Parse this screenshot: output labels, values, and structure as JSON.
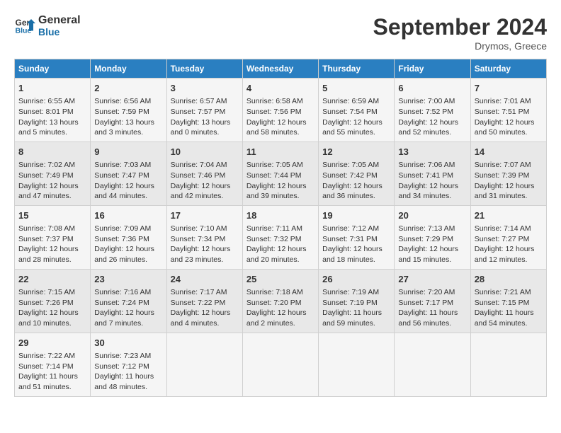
{
  "header": {
    "logo_line1": "General",
    "logo_line2": "Blue",
    "month_title": "September 2024",
    "subtitle": "Drymos, Greece"
  },
  "columns": [
    "Sunday",
    "Monday",
    "Tuesday",
    "Wednesday",
    "Thursday",
    "Friday",
    "Saturday"
  ],
  "weeks": [
    [
      {
        "day": "1",
        "lines": [
          "Sunrise: 6:55 AM",
          "Sunset: 8:01 PM",
          "Daylight: 13 hours",
          "and 5 minutes."
        ]
      },
      {
        "day": "2",
        "lines": [
          "Sunrise: 6:56 AM",
          "Sunset: 7:59 PM",
          "Daylight: 13 hours",
          "and 3 minutes."
        ]
      },
      {
        "day": "3",
        "lines": [
          "Sunrise: 6:57 AM",
          "Sunset: 7:57 PM",
          "Daylight: 13 hours",
          "and 0 minutes."
        ]
      },
      {
        "day": "4",
        "lines": [
          "Sunrise: 6:58 AM",
          "Sunset: 7:56 PM",
          "Daylight: 12 hours",
          "and 58 minutes."
        ]
      },
      {
        "day": "5",
        "lines": [
          "Sunrise: 6:59 AM",
          "Sunset: 7:54 PM",
          "Daylight: 12 hours",
          "and 55 minutes."
        ]
      },
      {
        "day": "6",
        "lines": [
          "Sunrise: 7:00 AM",
          "Sunset: 7:52 PM",
          "Daylight: 12 hours",
          "and 52 minutes."
        ]
      },
      {
        "day": "7",
        "lines": [
          "Sunrise: 7:01 AM",
          "Sunset: 7:51 PM",
          "Daylight: 12 hours",
          "and 50 minutes."
        ]
      }
    ],
    [
      {
        "day": "8",
        "lines": [
          "Sunrise: 7:02 AM",
          "Sunset: 7:49 PM",
          "Daylight: 12 hours",
          "and 47 minutes."
        ]
      },
      {
        "day": "9",
        "lines": [
          "Sunrise: 7:03 AM",
          "Sunset: 7:47 PM",
          "Daylight: 12 hours",
          "and 44 minutes."
        ]
      },
      {
        "day": "10",
        "lines": [
          "Sunrise: 7:04 AM",
          "Sunset: 7:46 PM",
          "Daylight: 12 hours",
          "and 42 minutes."
        ]
      },
      {
        "day": "11",
        "lines": [
          "Sunrise: 7:05 AM",
          "Sunset: 7:44 PM",
          "Daylight: 12 hours",
          "and 39 minutes."
        ]
      },
      {
        "day": "12",
        "lines": [
          "Sunrise: 7:05 AM",
          "Sunset: 7:42 PM",
          "Daylight: 12 hours",
          "and 36 minutes."
        ]
      },
      {
        "day": "13",
        "lines": [
          "Sunrise: 7:06 AM",
          "Sunset: 7:41 PM",
          "Daylight: 12 hours",
          "and 34 minutes."
        ]
      },
      {
        "day": "14",
        "lines": [
          "Sunrise: 7:07 AM",
          "Sunset: 7:39 PM",
          "Daylight: 12 hours",
          "and 31 minutes."
        ]
      }
    ],
    [
      {
        "day": "15",
        "lines": [
          "Sunrise: 7:08 AM",
          "Sunset: 7:37 PM",
          "Daylight: 12 hours",
          "and 28 minutes."
        ]
      },
      {
        "day": "16",
        "lines": [
          "Sunrise: 7:09 AM",
          "Sunset: 7:36 PM",
          "Daylight: 12 hours",
          "and 26 minutes."
        ]
      },
      {
        "day": "17",
        "lines": [
          "Sunrise: 7:10 AM",
          "Sunset: 7:34 PM",
          "Daylight: 12 hours",
          "and 23 minutes."
        ]
      },
      {
        "day": "18",
        "lines": [
          "Sunrise: 7:11 AM",
          "Sunset: 7:32 PM",
          "Daylight: 12 hours",
          "and 20 minutes."
        ]
      },
      {
        "day": "19",
        "lines": [
          "Sunrise: 7:12 AM",
          "Sunset: 7:31 PM",
          "Daylight: 12 hours",
          "and 18 minutes."
        ]
      },
      {
        "day": "20",
        "lines": [
          "Sunrise: 7:13 AM",
          "Sunset: 7:29 PM",
          "Daylight: 12 hours",
          "and 15 minutes."
        ]
      },
      {
        "day": "21",
        "lines": [
          "Sunrise: 7:14 AM",
          "Sunset: 7:27 PM",
          "Daylight: 12 hours",
          "and 12 minutes."
        ]
      }
    ],
    [
      {
        "day": "22",
        "lines": [
          "Sunrise: 7:15 AM",
          "Sunset: 7:26 PM",
          "Daylight: 12 hours",
          "and 10 minutes."
        ]
      },
      {
        "day": "23",
        "lines": [
          "Sunrise: 7:16 AM",
          "Sunset: 7:24 PM",
          "Daylight: 12 hours",
          "and 7 minutes."
        ]
      },
      {
        "day": "24",
        "lines": [
          "Sunrise: 7:17 AM",
          "Sunset: 7:22 PM",
          "Daylight: 12 hours",
          "and 4 minutes."
        ]
      },
      {
        "day": "25",
        "lines": [
          "Sunrise: 7:18 AM",
          "Sunset: 7:20 PM",
          "Daylight: 12 hours",
          "and 2 minutes."
        ]
      },
      {
        "day": "26",
        "lines": [
          "Sunrise: 7:19 AM",
          "Sunset: 7:19 PM",
          "Daylight: 11 hours",
          "and 59 minutes."
        ]
      },
      {
        "day": "27",
        "lines": [
          "Sunrise: 7:20 AM",
          "Sunset: 7:17 PM",
          "Daylight: 11 hours",
          "and 56 minutes."
        ]
      },
      {
        "day": "28",
        "lines": [
          "Sunrise: 7:21 AM",
          "Sunset: 7:15 PM",
          "Daylight: 11 hours",
          "and 54 minutes."
        ]
      }
    ],
    [
      {
        "day": "29",
        "lines": [
          "Sunrise: 7:22 AM",
          "Sunset: 7:14 PM",
          "Daylight: 11 hours",
          "and 51 minutes."
        ]
      },
      {
        "day": "30",
        "lines": [
          "Sunrise: 7:23 AM",
          "Sunset: 7:12 PM",
          "Daylight: 11 hours",
          "and 48 minutes."
        ]
      },
      null,
      null,
      null,
      null,
      null
    ]
  ]
}
